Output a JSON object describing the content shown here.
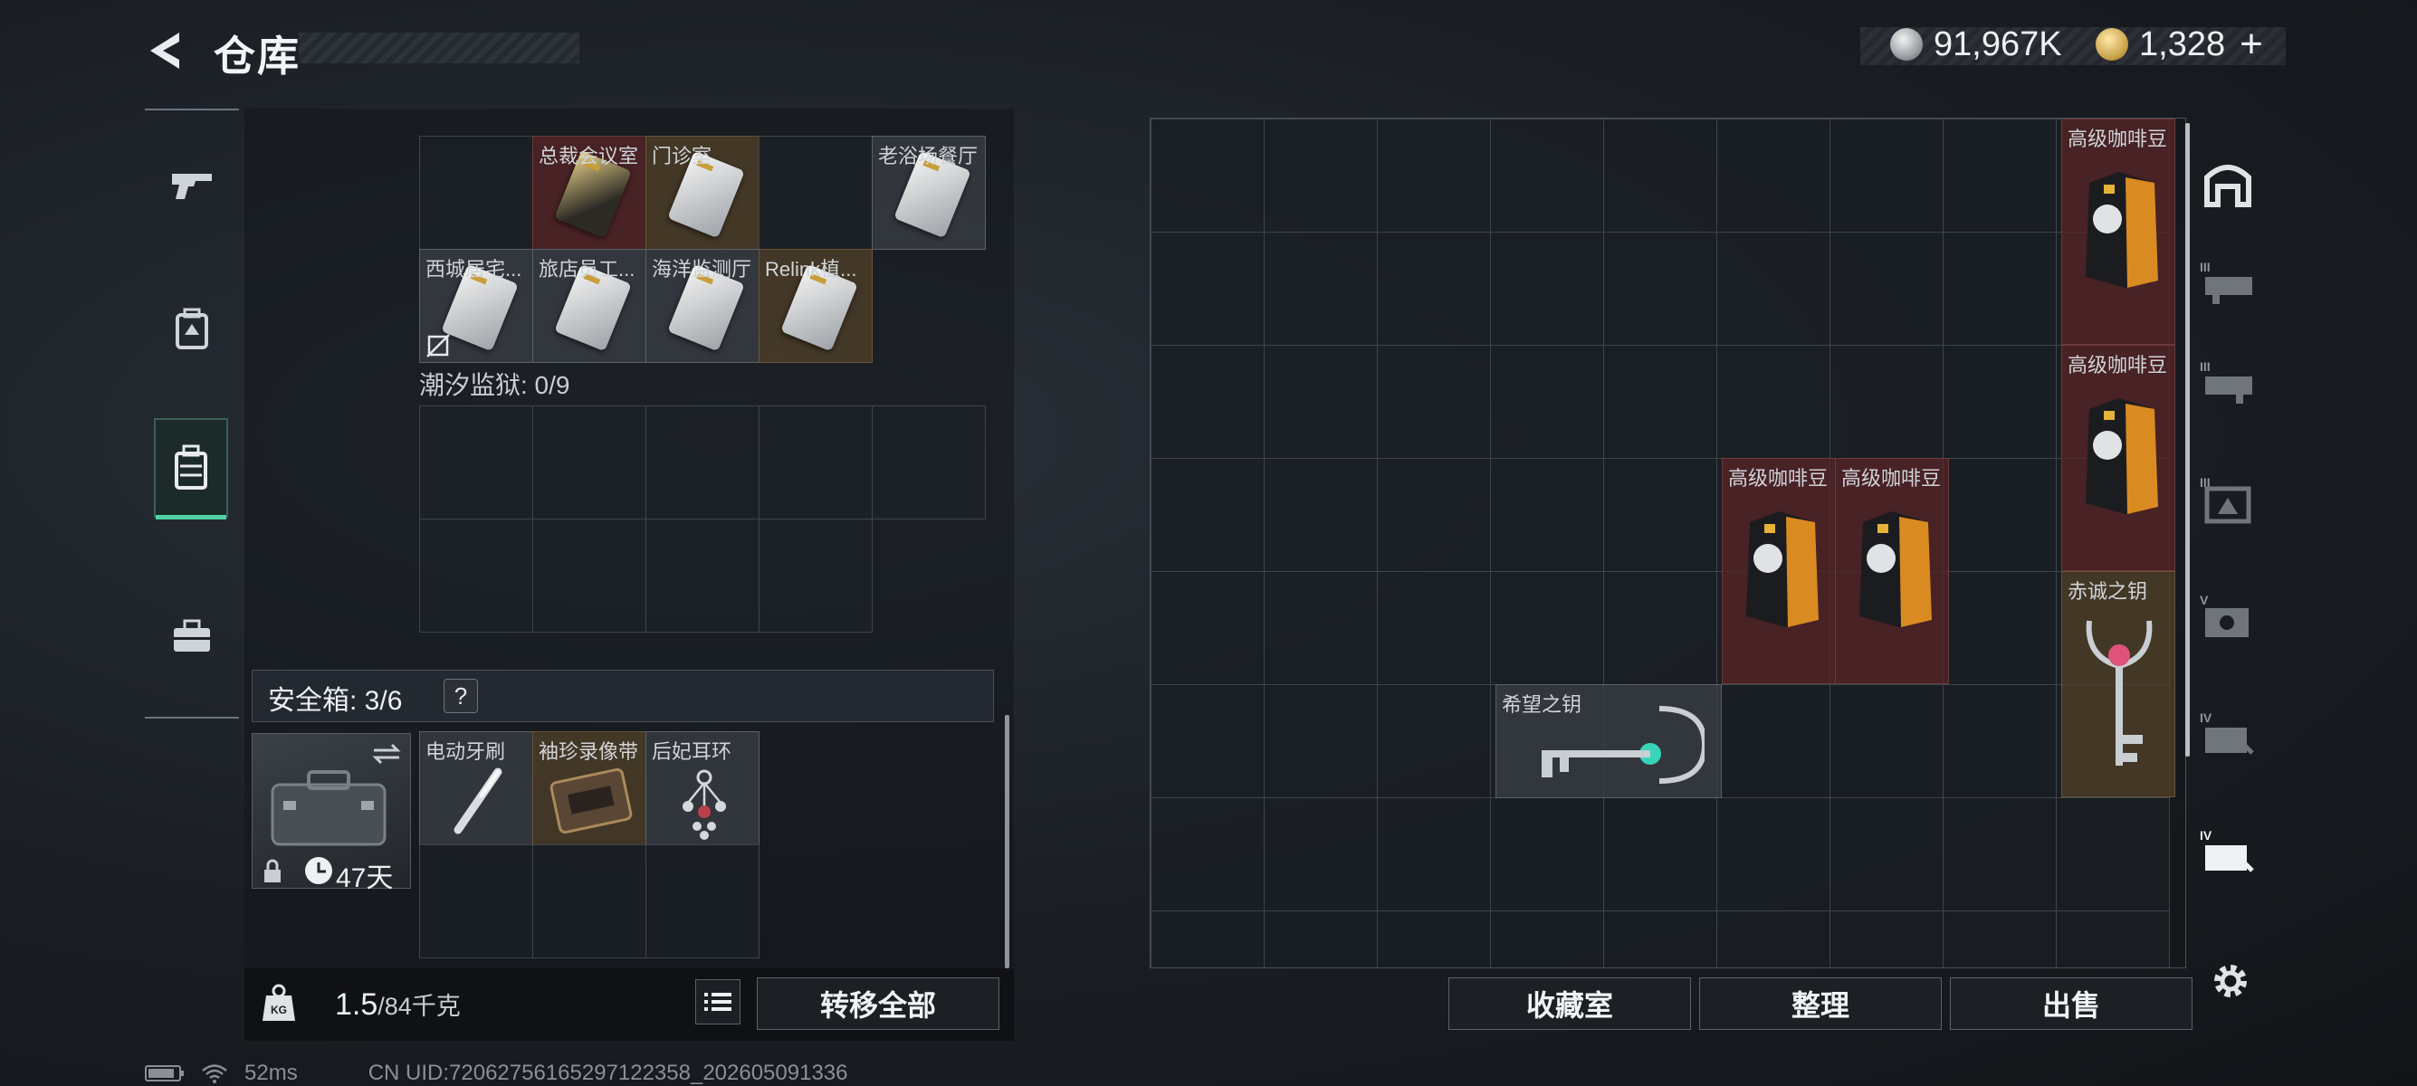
{
  "header": {
    "title": "仓库",
    "currency_silver": "91,967K",
    "currency_gold": "1,328",
    "plus": "+"
  },
  "nav": {
    "items": [
      {
        "icon": "gun-icon"
      },
      {
        "icon": "backpack-icon"
      },
      {
        "icon": "chest-rig-icon",
        "active": true
      },
      {
        "icon": "briefcase-icon"
      }
    ]
  },
  "keycards": {
    "cards": [
      {
        "label": "总裁会议室",
        "color": "red"
      },
      {
        "label": "门诊室",
        "color": "orange"
      },
      {
        "label": "老浴场餐厅",
        "color": "grey"
      },
      {
        "label": "西城居宅...",
        "color": "grey"
      },
      {
        "label": "旅店员工...",
        "color": "grey"
      },
      {
        "label": "海洋监测厅",
        "color": "grey"
      },
      {
        "label": "Relink植...",
        "color": "orange"
      }
    ],
    "prison_label": "潮汐监狱: 0/9"
  },
  "safe_box": {
    "label": "安全箱: 3/6",
    "help": "?",
    "days": "47天",
    "items": [
      {
        "label": "电动牙刷"
      },
      {
        "label": "袖珍录像带"
      },
      {
        "label": "后妃耳环"
      }
    ]
  },
  "footer_left": {
    "weight_value": "1.5",
    "weight_max": "/84千克",
    "transfer_all": "转移全部"
  },
  "stash": {
    "items": [
      {
        "label": "高级咖啡豆"
      },
      {
        "label": "高级咖啡豆"
      },
      {
        "label": "高级咖啡豆"
      },
      {
        "label": "高级咖啡豆"
      },
      {
        "label": "赤诚之钥"
      },
      {
        "label": "希望之钥"
      }
    ]
  },
  "footer_right": {
    "collection": "收藏室",
    "sort": "整理",
    "sell": "出售"
  },
  "status": {
    "ping": "52ms",
    "uid": "CN UID:7206275616529712235​8_202605091336"
  }
}
